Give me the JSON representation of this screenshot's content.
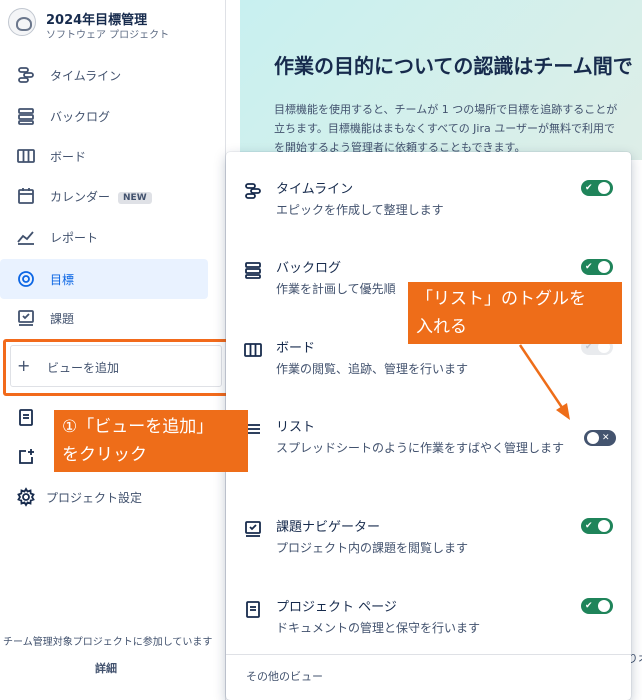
{
  "project": {
    "title": "2024年目標管理",
    "subtitle": "ソフトウェア プロジェクト"
  },
  "sidebar": {
    "items": [
      {
        "label": "タイムライン",
        "icon": "timeline-icon"
      },
      {
        "label": "バックログ",
        "icon": "backlog-icon"
      },
      {
        "label": "ボード",
        "icon": "board-icon"
      },
      {
        "label": "カレンダー",
        "icon": "calendar-icon",
        "badge": "NEW"
      },
      {
        "label": "レポート",
        "icon": "report-icon"
      },
      {
        "label": "目標",
        "icon": "goal-icon",
        "active": true
      },
      {
        "label": "課題",
        "icon": "issues-icon"
      }
    ],
    "add_view_label": "ビューを追加",
    "project_settings_label": "プロジェクト設定",
    "footer_text": "チーム管理対象プロジェクトに参加しています",
    "footer_link": "詳細"
  },
  "main": {
    "title": "作業の目的についての認識はチーム間で",
    "body_lines": [
      "目標機能を使用すると、チームが 1 つの場所で目標を追跡することが",
      "立ちます。目標機能はまもなくすべての Jira ユーザーが無料で利用で",
      "を開始するよう管理者に依頼することもできます。"
    ],
    "right_edge_text": "りオ"
  },
  "view_panel": {
    "options": [
      {
        "title": "タイムライン",
        "desc": "エピックを作成して整理します",
        "enabled": true
      },
      {
        "title": "バックログ",
        "desc": "作業を計画して優先順",
        "enabled": true
      },
      {
        "title": "ボード",
        "desc": "作業の閲覧、追跡、管理を行います",
        "enabled": true
      },
      {
        "title": "リスト",
        "desc": "スプレッドシートのように作業をすばやく管理します",
        "enabled": false
      },
      {
        "title": "課題ナビゲーター",
        "desc": "プロジェクト内の課題を閲覧します",
        "enabled": true
      },
      {
        "title": "プロジェクト ページ",
        "desc": "ドキュメントの管理と保守を行います",
        "enabled": true
      }
    ],
    "more_views": "その他のビュー"
  },
  "callouts": {
    "step1_line1": "①「ビューを追加」",
    "step1_line2": "をクリック",
    "toggle_line1": "「リスト」のトグルを",
    "toggle_line2": "入れる"
  },
  "colors": {
    "toggle_on": "#1f845a",
    "toggle_off": "#44546f",
    "callout": "#ee6d19",
    "active_nav": "#0c66e4"
  }
}
